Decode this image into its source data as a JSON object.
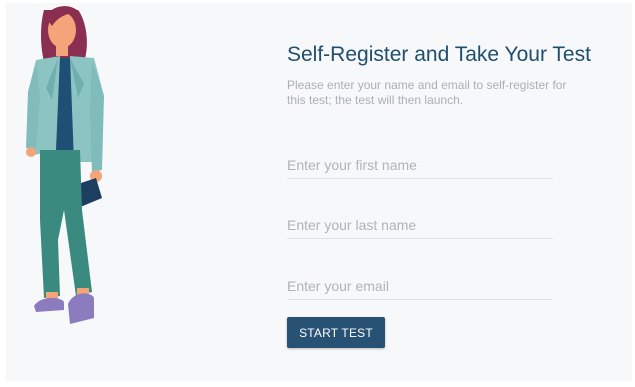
{
  "page": {
    "title": "Self-Register and Take Your Test",
    "subtitle": "Please enter your name and email to self-register for this test; the test will then launch."
  },
  "form": {
    "first_name_placeholder": "Enter your first name",
    "first_name_value": "",
    "last_name_placeholder": "Enter your last name",
    "last_name_value": "",
    "email_placeholder": "Enter your email",
    "email_value": "",
    "submit_label": "START TEST"
  },
  "colors": {
    "accent": "#275273",
    "title": "#1f4e6e",
    "muted_text": "#a9b0b6",
    "background": "#f7f8f9"
  },
  "illustration": {
    "icon": "woman-holding-tablet-illustration"
  }
}
